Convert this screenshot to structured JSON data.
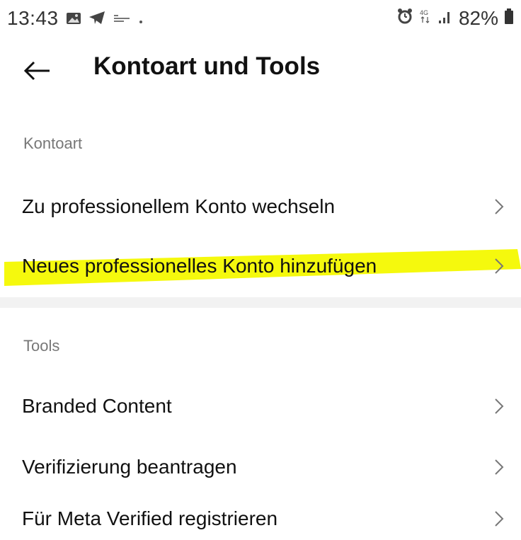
{
  "status_bar": {
    "time": "13:43",
    "battery": "82%",
    "network": "4G"
  },
  "header": {
    "title": "Kontoart und Tools"
  },
  "sections": {
    "account_type": {
      "title": "Kontoart",
      "items": [
        {
          "label": "Zu professionellem Konto wechseln"
        },
        {
          "label": "Neues professionelles Konto hinzufügen"
        }
      ]
    },
    "tools": {
      "title": "Tools",
      "items": [
        {
          "label": "Branded Content"
        },
        {
          "label": "Verifizierung beantragen"
        },
        {
          "label": "Für Meta Verified registrieren"
        }
      ]
    }
  },
  "colors": {
    "highlight": "#f5f90d",
    "divider": "#f2f2f2",
    "section_header": "#777777"
  }
}
